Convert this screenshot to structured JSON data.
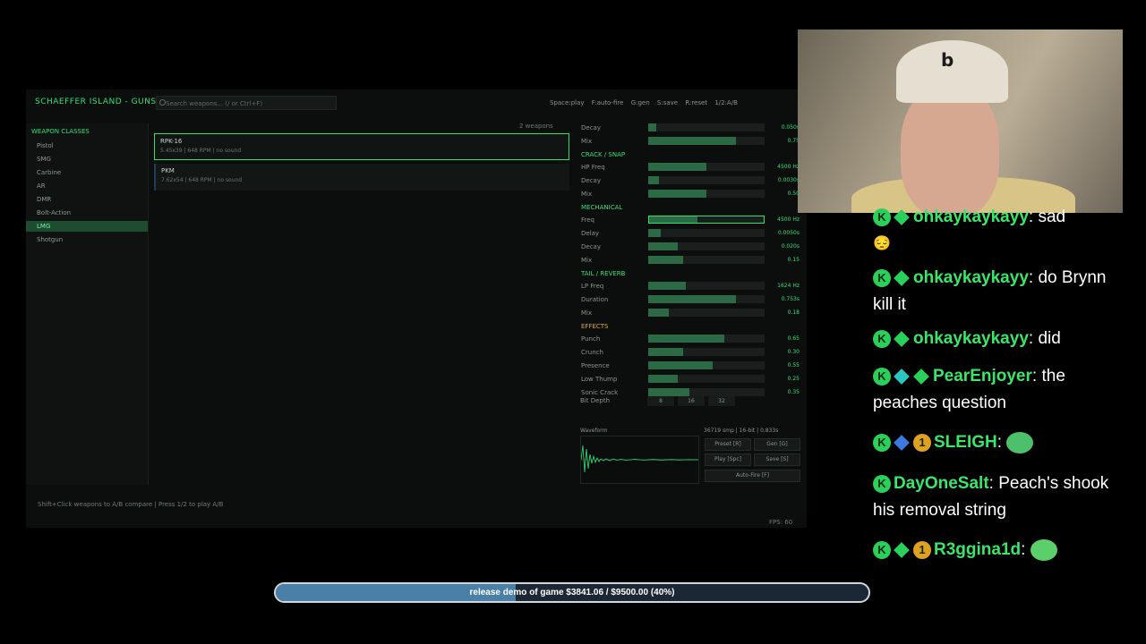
{
  "app": {
    "title": "SCHAEFFER ISLAND - GUNS",
    "search_placeholder": "Search weapons... (/ or Ctrl+F)",
    "top_actions": [
      "Space:play",
      "F:auto-fire",
      "G:gen",
      "S:save",
      "R:reset",
      "1/2:A/B"
    ]
  },
  "sidebar": {
    "heading": "WEAPON CLASSES",
    "items": [
      {
        "label": "Pistol"
      },
      {
        "label": "SMG"
      },
      {
        "label": "Carbine"
      },
      {
        "label": "AR"
      },
      {
        "label": "DMR"
      },
      {
        "label": "Bolt-Action"
      },
      {
        "label": "LMG",
        "active": true
      },
      {
        "label": "Shotgun"
      }
    ]
  },
  "weapon_list": {
    "count": "2 weapons",
    "items": [
      {
        "name": "RPK-16",
        "meta": "5.45x39  |  648 RPM  |  no sound",
        "selected": true
      },
      {
        "name": "PKM",
        "meta": "7.62x54  |  648 RPM  |  no sound",
        "selected": false
      }
    ]
  },
  "params": {
    "rows": [
      {
        "kind": "param",
        "label": "Decay",
        "value": "0.050s",
        "fill": 0.07
      },
      {
        "kind": "param",
        "label": "Mix",
        "value": "0.75",
        "fill": 0.75
      },
      {
        "kind": "section",
        "label": "CRACK / SNAP"
      },
      {
        "kind": "param",
        "label": "HP Freq",
        "value": "4500 Hz",
        "fill": 0.5
      },
      {
        "kind": "param",
        "label": "Decay",
        "value": "0.0030s",
        "fill": 0.09
      },
      {
        "kind": "param",
        "label": "Mix",
        "value": "0.50",
        "fill": 0.5
      },
      {
        "kind": "section",
        "label": "MECHANICAL"
      },
      {
        "kind": "param",
        "label": "Freq",
        "value": "4500 Hz",
        "fill": 0.42,
        "selected": true
      },
      {
        "kind": "param",
        "label": "Delay",
        "value": "0.0050s",
        "fill": 0.11
      },
      {
        "kind": "param",
        "label": "Decay",
        "value": "0.020s",
        "fill": 0.25
      },
      {
        "kind": "param",
        "label": "Mix",
        "value": "0.15",
        "fill": 0.3
      },
      {
        "kind": "section",
        "label": "TAIL / REVERB"
      },
      {
        "kind": "param",
        "label": "LP Freq",
        "value": "1624 Hz",
        "fill": 0.32
      },
      {
        "kind": "param",
        "label": "Duration",
        "value": "0.753s",
        "fill": 0.75
      },
      {
        "kind": "param",
        "label": "Mix",
        "value": "0.18",
        "fill": 0.18
      },
      {
        "kind": "section",
        "label": "EFFECTS",
        "fx": true
      },
      {
        "kind": "param",
        "label": "Punch",
        "value": "0.65",
        "fill": 0.65
      },
      {
        "kind": "param",
        "label": "Crunch",
        "value": "0.30",
        "fill": 0.3
      },
      {
        "kind": "param",
        "label": "Presence",
        "value": "0.55",
        "fill": 0.55
      },
      {
        "kind": "param",
        "label": "Low Thump",
        "value": "0.25",
        "fill": 0.25
      },
      {
        "kind": "param",
        "label": "Sonic Crack",
        "value": "0.35",
        "fill": 0.35
      }
    ],
    "bit_depth": {
      "label": "Bit Depth",
      "options": [
        "8",
        "16",
        "32"
      ]
    }
  },
  "waveform": {
    "title": "Waveform",
    "info": "36719 smp | 16-bit | 0.833s",
    "buttons": {
      "preset": "Preset [R]",
      "gen": "Gen [G]",
      "play": "Play [Spc]",
      "save": "Save [S]",
      "autofire": "Auto-Fire [F]"
    }
  },
  "footer": {
    "hint": "Shift+Click weapons to A/B compare  |  Press 1/2 to play A/B",
    "fps": "FPS: 60"
  },
  "chat": {
    "messages": [
      {
        "user": "ohkaykaykayy",
        "text": "sad",
        "emote": "pensive-emoji"
      },
      {
        "user": "ohkaykaykayy",
        "text": "do Brynn kill it"
      },
      {
        "user": "ohkaykaykayy",
        "text": "did"
      },
      {
        "user": "PearEnjoyer",
        "text": "the peaches question"
      },
      {
        "user": "SLEIGH",
        "text": "",
        "emote": "pepe-emote"
      },
      {
        "user": "DayOneSalt",
        "text": "Peach's shook his removal string"
      },
      {
        "user": "R3ggina1d",
        "text": "",
        "emote": "green-smile-emote"
      }
    ]
  },
  "goal": {
    "text": "release demo of game $3841.06 / $9500.00 (40%)",
    "progress": 0.4043,
    "fill_color": "#4a7fa8"
  },
  "colors": {
    "accent": "#33e07a",
    "fx_section": "#e0a53a",
    "bar_fill": "#2c6a45"
  }
}
